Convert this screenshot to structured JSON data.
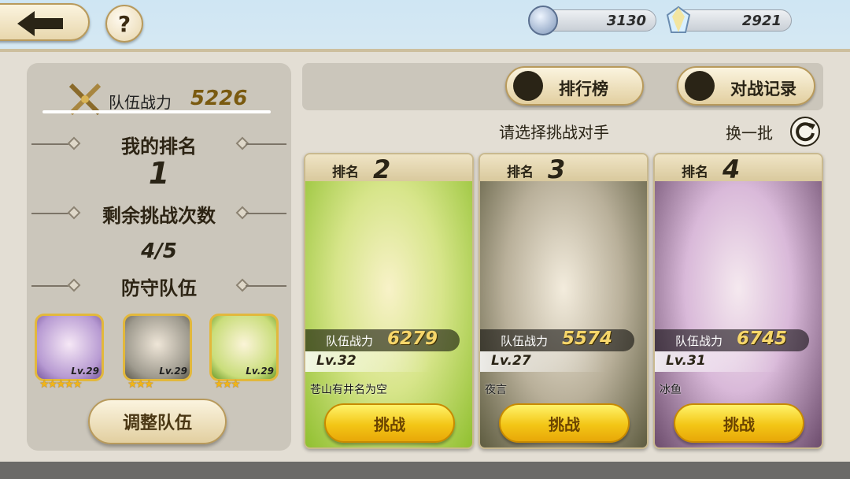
{
  "resources": {
    "currency1": {
      "value": "3130",
      "icon": "sword-coin-icon"
    },
    "currency2": {
      "value": "2921",
      "icon": "crystal-icon"
    }
  },
  "left": {
    "team_power_label": "队伍战力",
    "team_power_value": "5226",
    "my_rank_title": "我的排名",
    "my_rank_value": "1",
    "remaining_title": "剩余挑战次数",
    "remaining_value": "4/5",
    "defense_title": "防守队伍",
    "defense_team": [
      {
        "level": "Lv.29",
        "stars": "★★★★★"
      },
      {
        "level": "Lv.29",
        "stars": "★★★"
      },
      {
        "level": "Lv.29",
        "stars": "★★★"
      }
    ],
    "adjust_label": "调整队伍"
  },
  "right": {
    "ranking_label": "排行榜",
    "record_label": "对战记录",
    "select_prompt": "请选择挑战对手",
    "refresh_label": "换一批",
    "opponents": [
      {
        "rank_label": "排名",
        "rank": "2",
        "power_label": "队伍战力",
        "power": "6279",
        "level": "Lv.32",
        "name": "苍山有井名为空",
        "fight_label": "挑战"
      },
      {
        "rank_label": "排名",
        "rank": "3",
        "power_label": "队伍战力",
        "power": "5574",
        "level": "Lv.27",
        "name": "夜言",
        "fight_label": "挑战"
      },
      {
        "rank_label": "排名",
        "rank": "4",
        "power_label": "队伍战力",
        "power": "6745",
        "level": "Lv.31",
        "name": "冰鱼",
        "fight_label": "挑战"
      }
    ]
  },
  "colors": {
    "accent_gold": "#f3c616",
    "button_cream": "#fbf4df",
    "panel_gray": "#cbc6bb"
  }
}
